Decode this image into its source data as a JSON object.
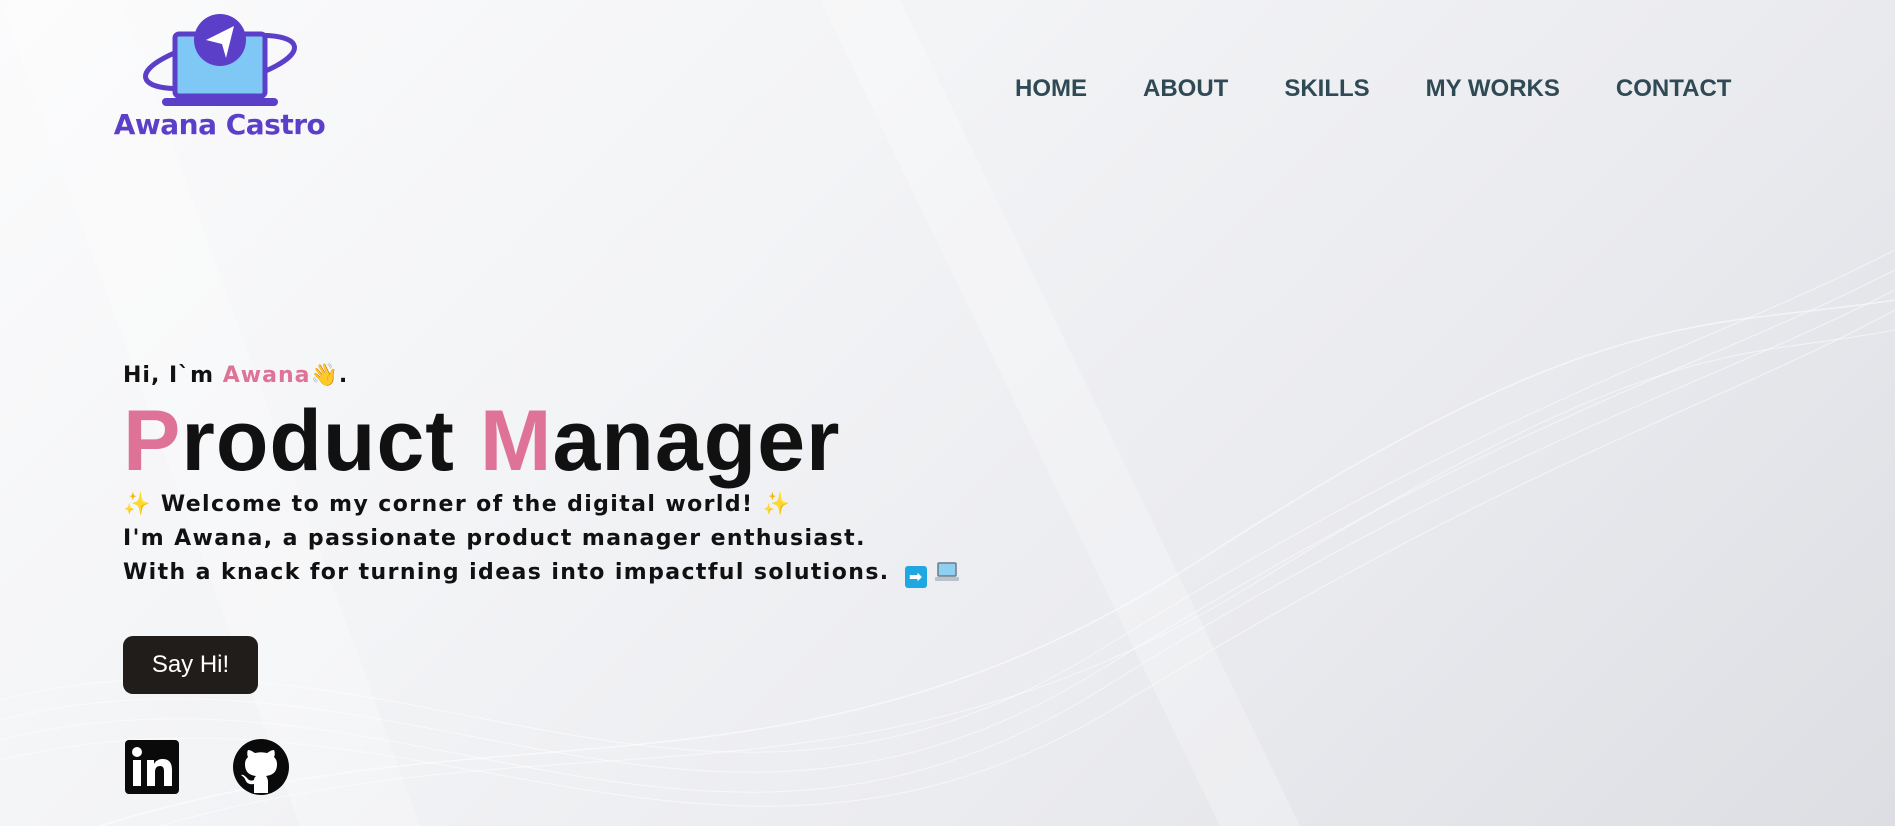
{
  "brand": {
    "name": "Awana Castro",
    "logo_icon": "laptop-paper-plane-icon",
    "colors": {
      "primary": "#5b3fc8",
      "screen": "#7fc8f5"
    }
  },
  "nav": {
    "items": [
      {
        "label": "HOME"
      },
      {
        "label": "ABOUT"
      },
      {
        "label": "SKILLS"
      },
      {
        "label": "MY WORKS"
      },
      {
        "label": "CONTACT"
      }
    ],
    "color": "#2f4a54"
  },
  "hero": {
    "greeting_prefix": "Hi, I`m ",
    "greeting_name": "Awana",
    "greeting_emoji": "👋",
    "greeting_suffix": ".",
    "title_word1_first": "P",
    "title_word1_rest": "roduct",
    "title_word2_first": "M",
    "title_word2_rest": "anager",
    "accent_color": "#de7397",
    "intro_line1_text": " Welcome to my corner of the digital world! ",
    "intro_line2": "I'm Awana, a passionate product manager enthusiast.",
    "intro_line3": "With a knack for turning ideas into impactful solutions. ",
    "sparkle_icon": "sparkles-icon",
    "arrow_icon": "right-arrow-icon",
    "laptop_icon": "laptop-icon"
  },
  "cta": {
    "label": "Say Hi!",
    "background": "#211d1a"
  },
  "socials": [
    {
      "name": "linkedin",
      "icon": "linkedin-icon"
    },
    {
      "name": "github",
      "icon": "github-icon"
    }
  ]
}
